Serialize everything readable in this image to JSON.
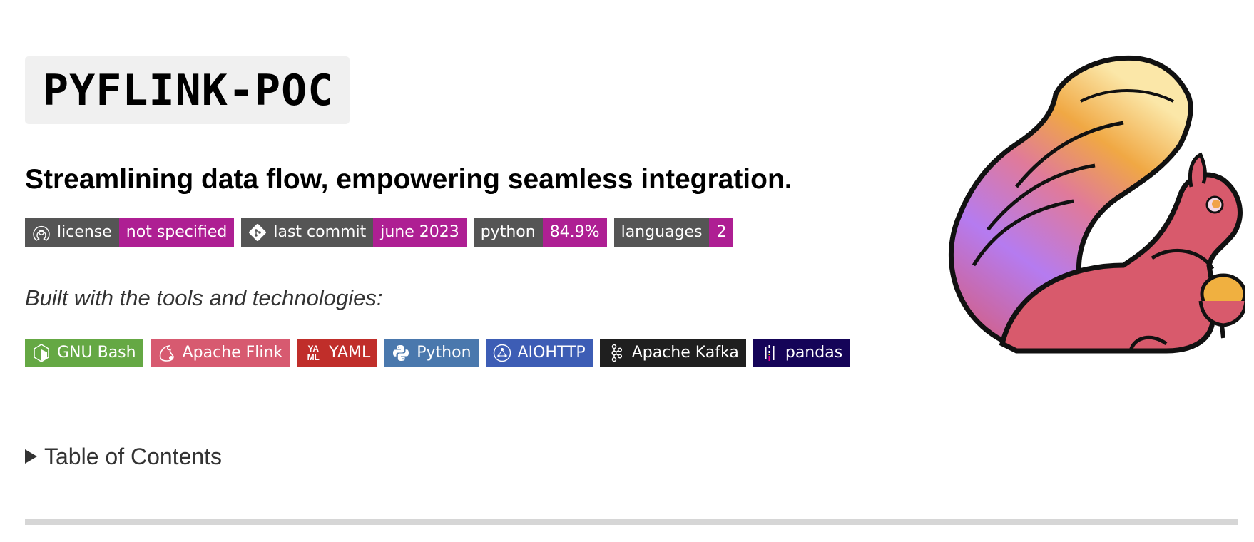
{
  "title": "PYFLINK-POC",
  "tagline": "Streamlining data flow, empowering seamless integration.",
  "meta_badges": [
    {
      "icon": "open-source-icon",
      "label": "license",
      "value": "not specified"
    },
    {
      "icon": "git-icon",
      "label": "last commit",
      "value": "june 2023"
    },
    {
      "icon": null,
      "label": "python",
      "value": "84.9%"
    },
    {
      "icon": null,
      "label": "languages",
      "value": "2"
    }
  ],
  "built_with_text": "Built with the tools and technologies:",
  "tech_badges": [
    {
      "icon": "gnu-bash-icon",
      "label": "GNU Bash",
      "color": "#65a844"
    },
    {
      "icon": "apache-flink-icon",
      "label": "Apache Flink",
      "color": "#d75a70"
    },
    {
      "icon": "yaml-icon",
      "label": "YAML",
      "color": "#c02e2a"
    },
    {
      "icon": "python-icon",
      "label": "Python",
      "color": "#4a78ad"
    },
    {
      "icon": "aiohttp-icon",
      "label": "AIOHTTP",
      "color": "#3d5db5"
    },
    {
      "icon": "apache-kafka-icon",
      "label": "Apache Kafka",
      "color": "#1f1f1f"
    },
    {
      "icon": "pandas-icon",
      "label": "pandas",
      "color": "#150458"
    }
  ],
  "toc_label": "Table of Contents",
  "colors": {
    "badge_label_bg": "#555555",
    "badge_value_bg": "#ae1f93",
    "title_bg": "#f0f0f0",
    "rule": "#d6d6d6"
  },
  "logo": "apache-flink-squirrel-logo"
}
